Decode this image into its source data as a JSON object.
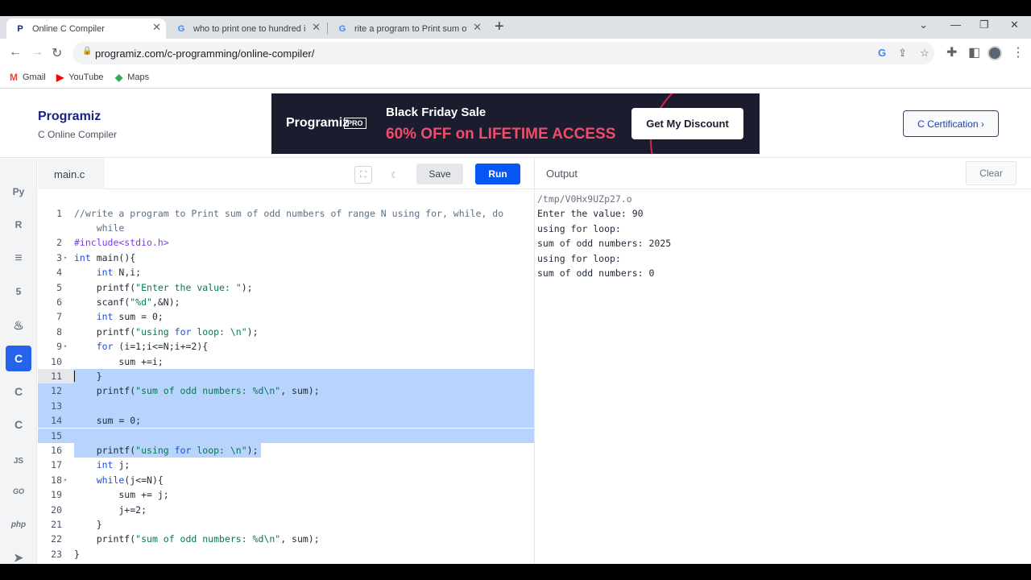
{
  "browser": {
    "tabs": [
      {
        "label": "Online C Compiler",
        "icon": "programiz-icon"
      },
      {
        "label": "who to print one to hundred in",
        "icon": "google-icon"
      },
      {
        "label": "rite a program to Print sum of o",
        "icon": "google-icon"
      }
    ],
    "url": "programiz.com/c-programming/online-compiler/",
    "bookmarks": [
      {
        "label": "Gmail",
        "icon": "gmail-icon"
      },
      {
        "label": "YouTube",
        "icon": "youtube-icon"
      },
      {
        "label": "Maps",
        "icon": "maps-icon"
      }
    ]
  },
  "header": {
    "logo": "Programiz",
    "subtitle": "C Online Compiler",
    "banner": {
      "logo": "Programiz",
      "badge": "PRO",
      "title": "Black Friday Sale",
      "offer": "60% OFF on LIFETIME ACCESS",
      "button": "Get My Discount"
    },
    "cert_button": "C Certification ›"
  },
  "sidebar": {
    "items": [
      {
        "name": "python",
        "label": "Py"
      },
      {
        "name": "r",
        "label": "R"
      },
      {
        "name": "sql",
        "label": "≡"
      },
      {
        "name": "html",
        "label": "5"
      },
      {
        "name": "java",
        "label": "♨"
      },
      {
        "name": "c",
        "label": "C"
      },
      {
        "name": "cpp",
        "label": "C"
      },
      {
        "name": "csharp",
        "label": "C"
      },
      {
        "name": "js",
        "label": "JS"
      },
      {
        "name": "go",
        "label": "GO"
      },
      {
        "name": "php",
        "label": "php"
      },
      {
        "name": "swift",
        "label": "➤"
      }
    ]
  },
  "editor": {
    "filename": "main.c",
    "save_label": "Save",
    "run_label": "Run",
    "lines": [
      {
        "n": "1",
        "text": "//write a program to Print sum of odd numbers of range N using for, while, do",
        "type": "cm"
      },
      {
        "n": "",
        "text": "    while",
        "type": "cm"
      },
      {
        "n": "2",
        "text": "#include<stdio.h>",
        "type": "pp"
      },
      {
        "n": "3",
        "text": "int main(){",
        "type": "code",
        "fold": true
      },
      {
        "n": "4",
        "text": "    int N,i;",
        "type": "code"
      },
      {
        "n": "5",
        "text": "    printf(\"Enter the value: \");",
        "type": "code"
      },
      {
        "n": "6",
        "text": "    scanf(\"%d\",&N);",
        "type": "code"
      },
      {
        "n": "7",
        "text": "    int sum = 0;",
        "type": "code"
      },
      {
        "n": "8",
        "text": "    printf(\"using for loop: \\n\");",
        "type": "code"
      },
      {
        "n": "9",
        "text": "    for (i=1;i<=N;i+=2){",
        "type": "code",
        "fold": true
      },
      {
        "n": "10",
        "text": "        sum +=i;",
        "type": "code"
      },
      {
        "n": "11",
        "text": "    }",
        "type": "code",
        "sel": true,
        "cur": true
      },
      {
        "n": "12",
        "text": "    printf(\"sum of odd numbers: %d\\n\", sum);",
        "type": "code",
        "sel": true
      },
      {
        "n": "13",
        "text": "",
        "type": "code",
        "sel": true
      },
      {
        "n": "14",
        "text": "    sum = 0;",
        "type": "code",
        "sel": true
      },
      {
        "n": "15",
        "text": "",
        "type": "code",
        "sel": true
      },
      {
        "n": "16",
        "text": "    printf(\"using for loop: \\n\");",
        "type": "code",
        "selpart": true
      },
      {
        "n": "17",
        "text": "    int j;",
        "type": "code"
      },
      {
        "n": "18",
        "text": "    while(j<=N){",
        "type": "code",
        "fold": true
      },
      {
        "n": "19",
        "text": "        sum += j;",
        "type": "code"
      },
      {
        "n": "20",
        "text": "        j+=2;",
        "type": "code"
      },
      {
        "n": "21",
        "text": "    }",
        "type": "code"
      },
      {
        "n": "22",
        "text": "    printf(\"sum of odd numbers: %d\\n\", sum);",
        "type": "code"
      },
      {
        "n": "23",
        "text": "}",
        "type": "code"
      }
    ]
  },
  "output": {
    "title": "Output",
    "clear_label": "Clear",
    "lines": [
      "/tmp/V0Hx9UZp27.o",
      "Enter the value: 90",
      "using for loop:",
      "sum of odd numbers: 2025",
      "using for loop:",
      "sum of odd numbers: 0"
    ]
  },
  "colors": {
    "run_button": "#0556f3",
    "selection": "#b8d4fd",
    "active_sidebar": "#2563eb",
    "banner_bg": "#1b1d2f",
    "banner_offer": "#f04c6b"
  }
}
